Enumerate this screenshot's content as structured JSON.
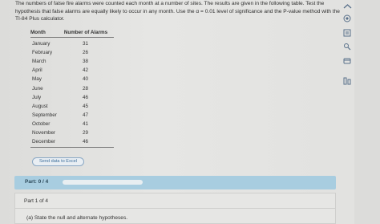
{
  "problem": {
    "intro": "The numbers of false fire alarms were counted each month at a number of sites. The results are given in the following table. Test the hypothesis that false alarms are equally likely to occur in any month. Use the α = 0.01 level of significance and the P-value method with the TI-84 Plus calculator."
  },
  "table": {
    "headers": [
      "Month",
      "Number of Alarms"
    ],
    "rows": [
      {
        "month": "January",
        "alarms": "31"
      },
      {
        "month": "February",
        "alarms": "26"
      },
      {
        "month": "March",
        "alarms": "38"
      },
      {
        "month": "April",
        "alarms": "42"
      },
      {
        "month": "May",
        "alarms": "40"
      },
      {
        "month": "June",
        "alarms": "28"
      },
      {
        "month": "July",
        "alarms": "46"
      },
      {
        "month": "August",
        "alarms": "45"
      },
      {
        "month": "September",
        "alarms": "47"
      },
      {
        "month": "October",
        "alarms": "41"
      },
      {
        "month": "November",
        "alarms": "29"
      },
      {
        "month": "December",
        "alarms": "46"
      }
    ]
  },
  "actions": {
    "send_excel": "Send data to Excel"
  },
  "part_bar": {
    "label": "Part: 0 / 4",
    "progress": 0
  },
  "sub_panel": {
    "part_of": "Part 1 of 4",
    "question": "(a) State the null and alternate hypotheses."
  },
  "sidebar_icons": [
    "expand-icon",
    "calculator-icon",
    "glossary-icon",
    "tools-icon",
    "formula-icon",
    "notes-icon"
  ]
}
